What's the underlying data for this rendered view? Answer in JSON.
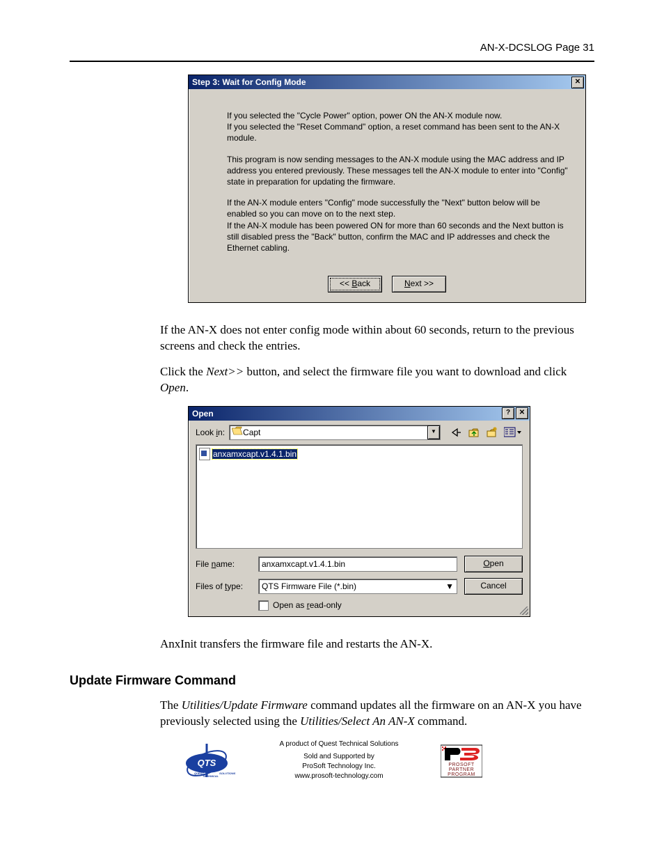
{
  "header": {
    "doc_id": "AN-X-DCSLOG  Page 31"
  },
  "dialog1": {
    "title": "Step 3: Wait for Config Mode",
    "close_glyph": "✕",
    "p1": "If you selected the \"Cycle Power\" option, power ON the AN-X module now.\nIf you selected the \"Reset Command\" option, a reset command has been sent to the AN-X module.",
    "p2": "This program is now sending messages to the AN-X module using the MAC address and IP address you entered previously. These messages tell the AN-X module to enter into \"Config\" state in preparation for updating the firmware.",
    "p3": "If the AN-X module enters \"Config\" mode successfully the \"Next\" button below will be enabled so you can move on to the next step.\nIf the AN-X module has been powered ON for more than 60 seconds and the Next button is still disabled press the \"Back\" button, confirm the MAC and IP addresses and check the Ethernet cabling.",
    "back_pre": "<< ",
    "back_u": "B",
    "back_post": "ack",
    "next_u": "N",
    "next_post": "ext >>"
  },
  "body": {
    "p1": "If the AN-X does not enter config mode within about 60 seconds, return to the previous screens and check the entries.",
    "p2a": "Click the ",
    "p2b": "Next>>",
    "p2c": " button, and select the firmware file you want to download and click ",
    "p2d": "Open",
    "p2e": "."
  },
  "dialog2": {
    "title": "Open",
    "help_glyph": "?",
    "close_glyph": "✕",
    "lookin_label_pre": "Look ",
    "lookin_label_u": "i",
    "lookin_label_post": "n:",
    "lookin_value": "Capt",
    "selected_file": "anxamxcapt.v1.4.1.bin",
    "filename_label_pre": "File ",
    "filename_label_u": "n",
    "filename_label_post": "ame:",
    "filename_value": "anxamxcapt.v1.4.1.bin",
    "filetype_label_pre": "Files of ",
    "filetype_label_u": "t",
    "filetype_label_post": "ype:",
    "filetype_value": "QTS Firmware File (*.bin)",
    "readonly_pre": "Open as ",
    "readonly_u": "r",
    "readonly_post": "ead-only",
    "open_u": "O",
    "open_post": "pen",
    "cancel": "Cancel"
  },
  "body2": {
    "p3": "AnxInit transfers the firmware file and restarts the AN-X."
  },
  "section": {
    "heading": "Update Firmware Command",
    "p4a": "The ",
    "p4b": "Utilities/Update Firmware",
    "p4c": " command updates all the firmware on an AN-X you have previously selected using the ",
    "p4d": "Utilities/Select An AN-X",
    "p4e": " command."
  },
  "footer": {
    "l1": "A product of Quest Technical Solutions",
    "l2": "Sold and Supported by",
    "l3": "ProSoft Technology Inc.",
    "l4": "www.prosoft-technology.com"
  }
}
